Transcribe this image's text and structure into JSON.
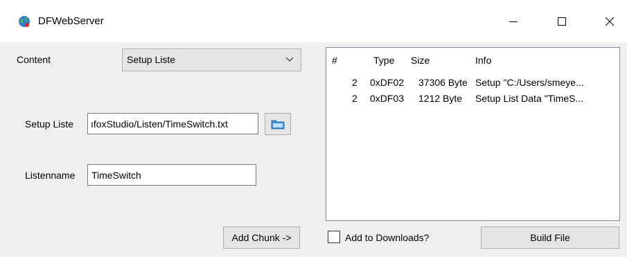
{
  "window": {
    "title": "DFWebServer",
    "icons": {
      "app": "globe-icon",
      "minimize": "minimize-icon",
      "maximize": "maximize-icon",
      "close": "close-icon"
    }
  },
  "form": {
    "content_label": "Content",
    "content_value": "Setup Liste",
    "setup_liste_label": "Setup Liste",
    "setup_liste_value": "ıfoxStudio/Listen/TimeSwitch.txt",
    "listenname_label": "Listenname",
    "listenname_value": "TimeSwitch",
    "add_chunk_label": "Add Chunk ->"
  },
  "table": {
    "headers": [
      "#",
      "Type",
      "Size",
      "Info"
    ],
    "rows": [
      [
        "2",
        "0xDF02",
        "37306 Byte",
        "Setup \"C:/Users/smeye..."
      ],
      [
        "2",
        "0xDF03",
        "1212 Byte",
        "Setup List Data \"TimeS..."
      ]
    ]
  },
  "footer": {
    "add_to_downloads_label": "Add to Downloads?",
    "add_to_downloads_checked": false,
    "build_file_label": "Build File"
  }
}
